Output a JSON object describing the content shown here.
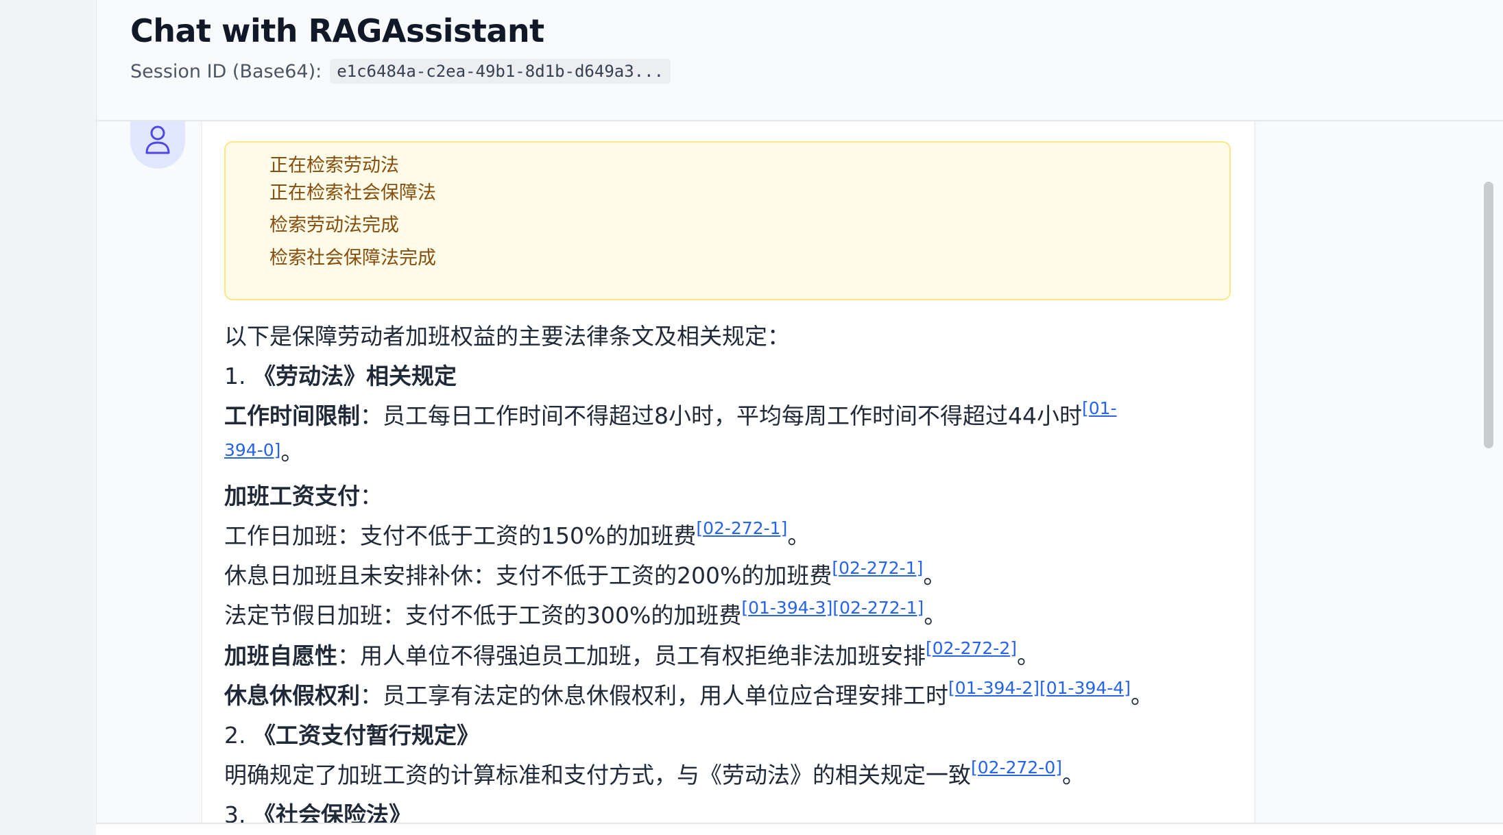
{
  "header": {
    "title": "Chat with RAGAssistant",
    "session_label": "Session ID (Base64):",
    "session_value": "e1c6484a-c2ea-49b1-8d1b-d649a3..."
  },
  "avatar": {
    "icon": "user-icon"
  },
  "status_lines": [
    "正在检索劳动法",
    "正在检索社会保障法",
    "检索劳动法完成",
    "检索社会保障法完成"
  ],
  "answer": {
    "intro": "以下是保障劳动者加班权益的主要法律条文及相关规定：",
    "sec1_num": "1.",
    "sec1_title": "《劳动法》相关规定",
    "work_time": {
      "label": "工作时间限制",
      "colon": "：",
      "text": "员工每日工作时间不得超过8小时，平均每周工作时间不得超过44小时",
      "cite1": "[01-",
      "cite2": "394-0]",
      "end": "。"
    },
    "pay_heading": {
      "label": "加班工资支付",
      "colon": "："
    },
    "workday": {
      "text": "工作日加班：支付不低于工资的150%的加班费",
      "cite": "[02-272-1]",
      "end": "。"
    },
    "restday": {
      "text": "休息日加班且未安排补休：支付不低于工资的200%的加班费",
      "cite": "[02-272-1]",
      "end": "。"
    },
    "holiday": {
      "text": "法定节假日加班：支付不低于工资的300%的加班费",
      "cite_a": "[01-394-3]",
      "cite_b": "[02-272-1]",
      "end": "。"
    },
    "voluntary": {
      "label": "加班自愿性",
      "colon": "：",
      "text": "用人单位不得强迫员工加班，员工有权拒绝非法加班安排",
      "cite": "[02-272-2]",
      "end": "。"
    },
    "rest": {
      "label": "休息休假权利",
      "colon": "：",
      "text": "员工享有法定的休息休假权利，用人单位应合理安排工时",
      "cite_a": "[01-394-2]",
      "cite_b": "[01-394-4]",
      "end": "。"
    },
    "sec2_num": "2.",
    "sec2_title": "《工资支付暂行规定》",
    "sec2_text": {
      "text": "明确规定了加班工资的计算标准和支付方式，与《劳动法》的相关规定一致",
      "cite": "[02-272-0]",
      "end": "。"
    },
    "sec3_num": "3.",
    "sec3_title": "《社会保险法》"
  },
  "colors": {
    "status_bg": "#fefce8",
    "status_border": "#fde68a",
    "status_text": "#854d0e",
    "citation": "#2563eb",
    "avatar_bg": "#e0e7ff",
    "avatar_icon": "#4f46e5"
  }
}
